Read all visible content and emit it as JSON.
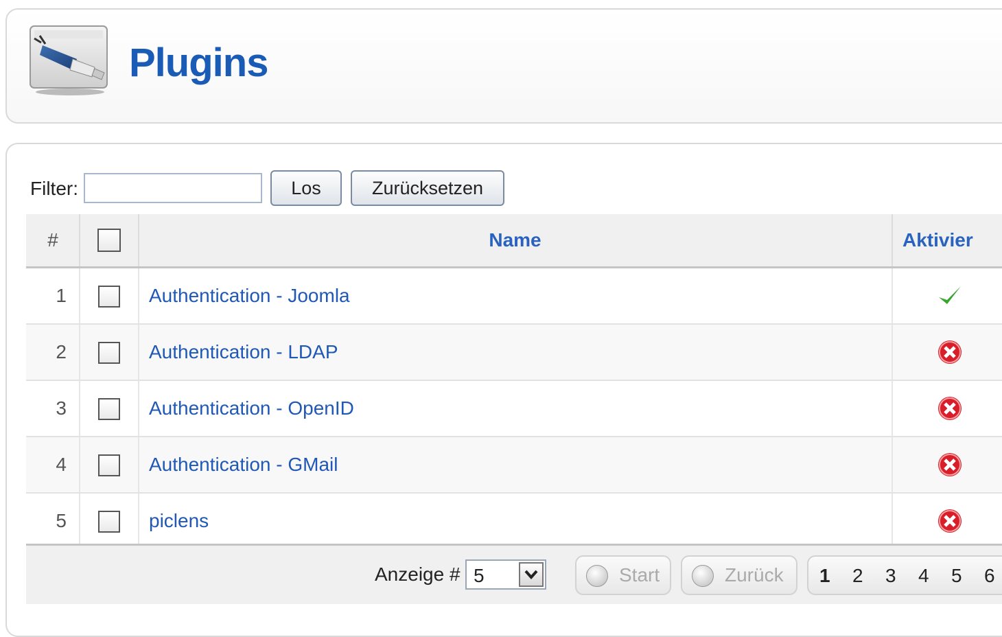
{
  "header": {
    "title": "Plugins",
    "icon": "plugin-plug-icon"
  },
  "filter": {
    "label": "Filter:",
    "value": "",
    "go_label": "Los",
    "reset_label": "Zurücksetzen"
  },
  "table": {
    "columns": {
      "num": "#",
      "name": "Name",
      "active": "Aktivier"
    },
    "rows": [
      {
        "num": "1",
        "name": "Authentication - Joomla",
        "enabled": true
      },
      {
        "num": "2",
        "name": "Authentication - LDAP",
        "enabled": false
      },
      {
        "num": "3",
        "name": "Authentication - OpenID",
        "enabled": false
      },
      {
        "num": "4",
        "name": "Authentication - GMail",
        "enabled": false
      },
      {
        "num": "5",
        "name": "piclens",
        "enabled": false
      }
    ]
  },
  "footer": {
    "display_label": "Anzeige #",
    "limit_value": "5",
    "start_label": "Start",
    "prev_label": "Zurück",
    "pages": [
      "1",
      "2",
      "3",
      "4",
      "5",
      "6"
    ],
    "current_page": "1"
  },
  "colors": {
    "title": "#1a5bb5",
    "link": "#1f58b5",
    "enabled": "#3aa52e",
    "disabled": "#d81e2a"
  }
}
